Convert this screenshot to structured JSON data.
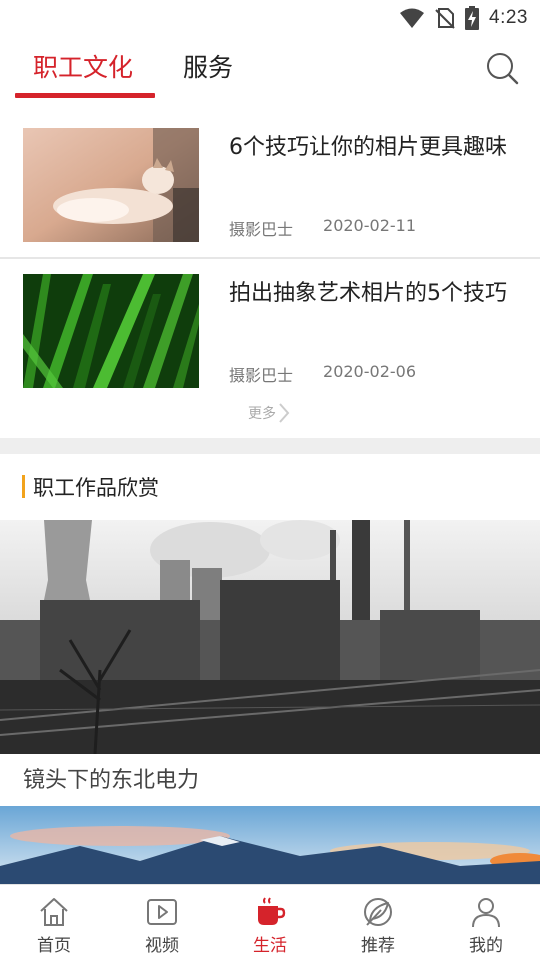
{
  "status_bar": {
    "time": "4:23",
    "icons": [
      "wifi-icon",
      "no-sim-icon",
      "battery-charging-icon"
    ]
  },
  "header": {
    "tabs": [
      {
        "label": "职工文化",
        "active": true
      },
      {
        "label": "服务",
        "active": false
      }
    ],
    "search_icon": "search-icon",
    "accent_color": "#d5232b"
  },
  "news": {
    "items": [
      {
        "title": "6个技巧让你的相片更具趣味",
        "author": "摄影巴士",
        "date": "2020-02-11",
        "thumb": "cat-photo"
      },
      {
        "title": "拍出抽象艺术相片的5个技巧",
        "author": "摄影巴士",
        "date": "2020-02-06",
        "thumb": "green-grass-photo"
      }
    ],
    "more_label": "更多"
  },
  "works": {
    "section_title": "职工作品欣赏",
    "section_bar_color": "#f2a31c",
    "items": [
      {
        "caption": "镜头下的东北电力",
        "image": "industrial-plant-photo"
      },
      {
        "caption": "",
        "image": "mountain-sky-photo"
      }
    ]
  },
  "bottom_nav": {
    "items": [
      {
        "label": "首页",
        "icon": "home-icon",
        "active": false
      },
      {
        "label": "视频",
        "icon": "video-play-icon",
        "active": false
      },
      {
        "label": "生活",
        "icon": "coffee-cup-icon",
        "active": true
      },
      {
        "label": "推荐",
        "icon": "leaf-icon",
        "active": false
      },
      {
        "label": "我的",
        "icon": "user-icon",
        "active": false
      }
    ]
  }
}
